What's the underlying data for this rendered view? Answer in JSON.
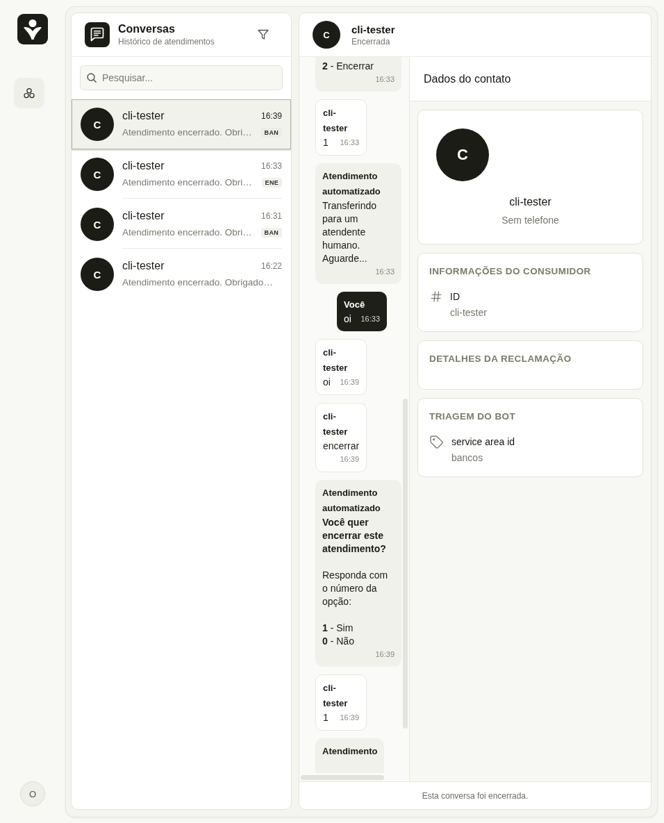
{
  "rail": {
    "user_initial": "O"
  },
  "conversations": {
    "title": "Conversas",
    "subtitle": "Histórico de atendimentos",
    "search": {
      "placeholder": "Pesquisar..."
    },
    "items": [
      {
        "avatar": "C",
        "name": "cli-tester",
        "time": "16:39",
        "preview": "Atendimento encerrado. Obri…",
        "tag": "BAN",
        "selected": true
      },
      {
        "avatar": "C",
        "name": "cli-tester",
        "time": "16:33",
        "preview": "Atendimento encerrado. Obri…",
        "tag": "ENE",
        "selected": false
      },
      {
        "avatar": "C",
        "name": "cli-tester",
        "time": "16:31",
        "preview": "Atendimento encerrado. Obri…",
        "tag": "BAN",
        "selected": false
      },
      {
        "avatar": "C",
        "name": "cli-tester",
        "time": "16:22",
        "preview": "Atendimento encerrado. Obrigado…",
        "selected": false
      }
    ]
  },
  "chat": {
    "header": {
      "avatar": "C",
      "name": "cli-tester",
      "status": "Encerrada"
    },
    "messages": [
      {
        "kind": "bot",
        "text": "**2** - Encerrar",
        "time": "16:33"
      },
      {
        "kind": "client",
        "sender": "cli-tester",
        "text": "1",
        "time": "16:33"
      },
      {
        "kind": "bot",
        "sender": "Atendimento automatizado",
        "text": "Transferindo para um atendente humano. Aguarde...",
        "time": "16:33"
      },
      {
        "kind": "agent",
        "sender": "Você",
        "text": "oi",
        "time": "16:33"
      },
      {
        "kind": "client",
        "sender": "cli-tester",
        "text": "oi",
        "time": "16:39"
      },
      {
        "kind": "client",
        "sender": "cli-tester",
        "text": "encerrar",
        "time": "16:39"
      },
      {
        "kind": "bot",
        "sender": "Atendimento automatizado",
        "text": "**Você quer encerrar este atendimento?**\n\nResponda com o número da opção:\n\n**1** - Sim\n**0** - Não",
        "time": "16:39"
      },
      {
        "kind": "client",
        "sender": "cli-tester",
        "text": "1",
        "time": "16:39"
      },
      {
        "kind": "bot",
        "sender": "Atendimento"
      }
    ],
    "footer": "Esta conversa foi encerrada."
  },
  "contact": {
    "title": "Dados do contato",
    "profile": {
      "avatar": "C",
      "name": "cli-tester",
      "phone": "Sem telefone"
    },
    "sections": [
      {
        "title": "INFORMAÇÕES DO CONSUMIDOR",
        "fields": [
          {
            "kind": "hash",
            "label": "ID",
            "value": "cli-tester"
          }
        ]
      },
      {
        "title": "DETALHES DA RECLAMAÇÃO"
      },
      {
        "title": "TRIAGEM DO BOT",
        "fields": [
          {
            "kind": "tag",
            "label": "service area id",
            "value": "bancos"
          }
        ]
      }
    ]
  }
}
